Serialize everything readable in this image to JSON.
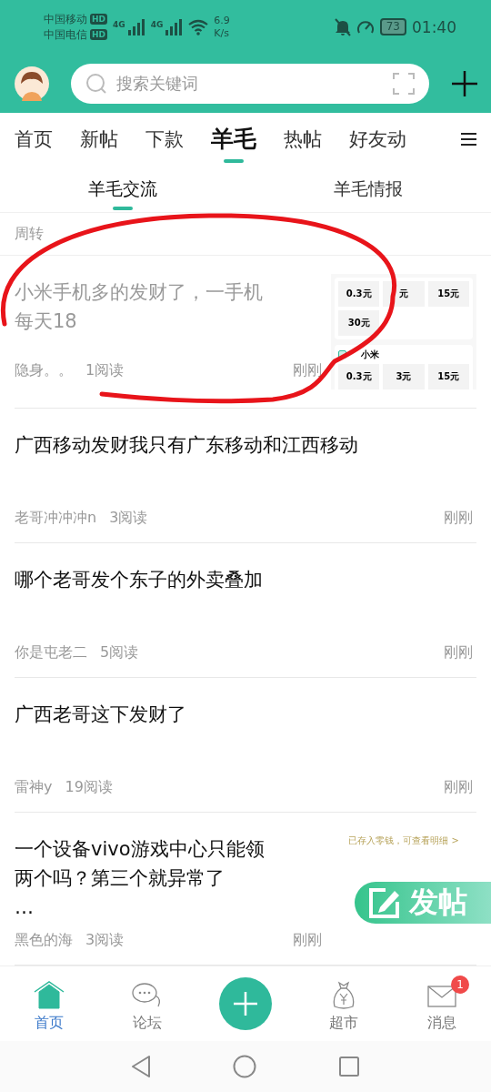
{
  "status_bar": {
    "carriers": [
      {
        "name": "中国移动",
        "badge": "HD"
      },
      {
        "name": "中国电信",
        "badge": "HD"
      }
    ],
    "networks": [
      {
        "type": "4G"
      },
      {
        "type": "4G"
      }
    ],
    "speed": [
      "6.9",
      "K/s"
    ],
    "battery": "73",
    "time": "01:40"
  },
  "header": {
    "search": {
      "placeholder": "搜索关键词"
    }
  },
  "tabs": [
    {
      "label": "首页",
      "selected": false
    },
    {
      "label": "新帖",
      "selected": false
    },
    {
      "label": "下款",
      "selected": false
    },
    {
      "label": "羊毛",
      "selected": true
    },
    {
      "label": "热帖",
      "selected": false
    },
    {
      "label": "好友动",
      "selected": false
    }
  ],
  "sub_tabs": [
    {
      "label": "羊毛交流",
      "selected": true
    },
    {
      "label": "羊毛情报",
      "selected": false
    }
  ],
  "section_label": "周转",
  "posts": [
    {
      "title": [
        "小米手机多的发财了，一手机",
        "每天18"
      ],
      "author": "隐身。。",
      "reads": "1阅读",
      "time": "刚刚",
      "read": true,
      "thumbnail": {
        "kind": "screenshot",
        "cards": [
          {
            "cells": [
              "0.3元",
              "元",
              "15元",
              "30元"
            ]
          },
          {
            "title": "小米",
            "cells": [
              "0.3元",
              "3元",
              "15元"
            ]
          }
        ]
      }
    },
    {
      "title": [
        "广西移动发财我只有广东移动和江西移动"
      ],
      "author": "老哥冲冲冲n",
      "reads": "3阅读",
      "time": "刚刚",
      "read": false
    },
    {
      "title": [
        "哪个老哥发个东子的外卖叠加"
      ],
      "author": "你是屯老二",
      "reads": "5阅读",
      "time": "刚刚",
      "read": false
    },
    {
      "title": [
        "广西老哥这下发财了"
      ],
      "author": "雷神y",
      "reads": "19阅读",
      "time": "刚刚",
      "read": false
    },
    {
      "title": [
        "一个设备vivo游戏中心只能领",
        "两个吗？第三个就异常了",
        "…"
      ],
      "author": "黑色的海",
      "reads": "3阅读",
      "time": "刚刚",
      "read": false,
      "thumbnail": {
        "kind": "note",
        "text": "已存入零钱，可查看明细 >"
      }
    }
  ],
  "fab": {
    "label": "发帖"
  },
  "bottom_nav": [
    {
      "label": "首页",
      "kind": "home",
      "selected": true
    },
    {
      "label": "论坛",
      "kind": "forum",
      "selected": false
    },
    {
      "kind": "add"
    },
    {
      "label": "超市",
      "kind": "market",
      "selected": false
    },
    {
      "label": "消息",
      "kind": "messages",
      "selected": false,
      "badge": "1"
    }
  ]
}
